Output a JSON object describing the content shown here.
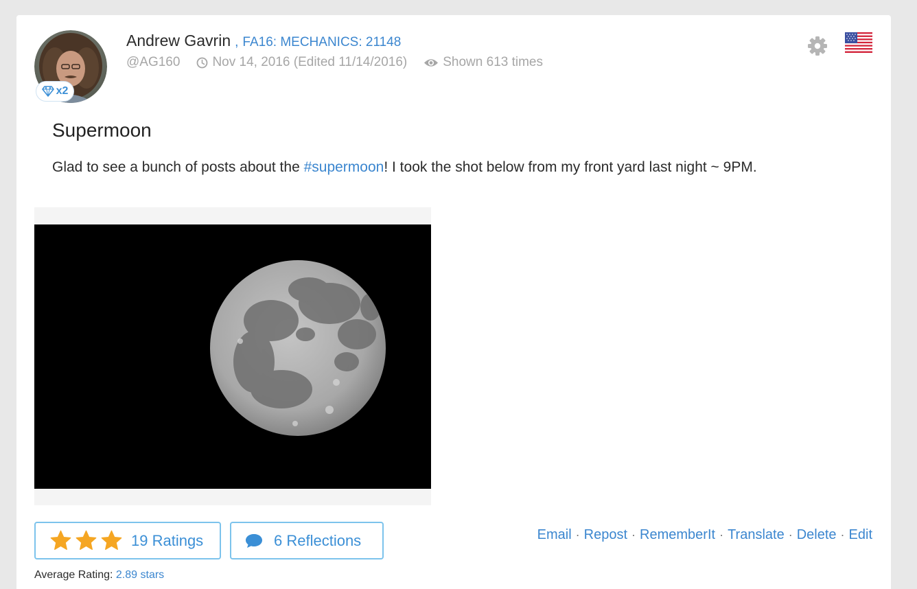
{
  "post": {
    "author": {
      "name": "Andrew Gavrin",
      "separator": ",",
      "course": "FA16: MECHANICS: 21148",
      "handle": "@AG160",
      "badge_count": "x2"
    },
    "meta": {
      "date": "Nov 14, 2016 (Edited 11/14/2016)",
      "views": "Shown 613 times"
    },
    "title": "Supermoon",
    "body": {
      "before": "Glad to see a bunch of posts about the ",
      "hashtag": "#supermoon",
      "after": "! I took the shot below from my front yard last night ~ 9PM."
    },
    "rating_stars": 3,
    "ratings_label": "19 Ratings",
    "reflections_label": "6 Reflections",
    "actions": {
      "email": "Email",
      "repost": "Repost",
      "rememberit": "RememberIt",
      "translate": "Translate",
      "delete": "Delete",
      "edit": "Edit",
      "separator": "·"
    },
    "average_rating": {
      "label": "Average Rating:",
      "value": "2.89 stars"
    }
  },
  "colors": {
    "accent": "#3b86cf",
    "border": "#7cc3ec",
    "star": "#f5a623",
    "muted": "#a6a6a6"
  },
  "icons": {
    "badge": "diamond-icon",
    "date": "clock-icon",
    "views": "eye-icon",
    "settings": "gear-icon",
    "language": "us-flag-icon",
    "rating": "star-icon",
    "reflections": "speech-bubble-icon"
  }
}
